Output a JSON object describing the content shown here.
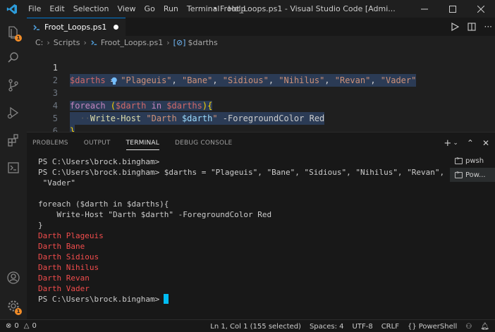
{
  "titlebar": {
    "menu": [
      "File",
      "Edit",
      "Selection",
      "View",
      "Go",
      "Run",
      "Terminal",
      "Help"
    ],
    "title": "• Froot_Loops.ps1 - Visual Studio Code [Admi..."
  },
  "activitybar": {
    "icons": [
      "explorer-icon",
      "search-icon",
      "source-control-icon",
      "run-debug-icon",
      "extensions-icon",
      "remote-explorer-icon"
    ],
    "explorer_badge": "1",
    "settings_badge": "1"
  },
  "editor": {
    "tab_label": "Froot_Loops.ps1",
    "breadcrumb": [
      "C:",
      "Scripts",
      "Froot_Loops.ps1",
      "$darths"
    ],
    "line_numbers": [
      "1",
      "2",
      "3",
      "4",
      "5",
      "6"
    ],
    "line1": {
      "var": "$darths",
      "assign": " = ",
      "items": [
        "\"Plageuis\"",
        "\"Bane\"",
        "\"Sidious\"",
        "\"Nihilus\"",
        "\"Revan\"",
        "\"Vader\""
      ],
      "sep": ", "
    },
    "line3": {
      "keyword": "foreach",
      "open": " (",
      "var1": "$darth",
      "in": " in ",
      "var2": "$darths",
      "close": "){"
    },
    "line4": {
      "indent": "  ··",
      "cmd": "Write-Host",
      "str_open": " \"Darth ",
      "str_var": "$darth",
      "str_close": "\"",
      "param": " -ForegroundColor",
      "value": " Red"
    },
    "line5": "}"
  },
  "panel": {
    "tabs": [
      "PROBLEMS",
      "OUTPUT",
      "TERMINAL",
      "DEBUG CONSOLE"
    ],
    "active_tab": "TERMINAL",
    "terminal_lines": [
      "PS C:\\Users\\brock.bingham>",
      "PS C:\\Users\\brock.bingham> $darths = \"Plageuis\", \"Bane\", \"Sidious\", \"Nihilus\", \"Revan\",",
      " \"Vader\"",
      "",
      "foreach ($darth in $darths){",
      "    Write-Host \"Darth $darth\" -ForegroundColor Red",
      "}"
    ],
    "output_lines": [
      "Darth Plageuis",
      "Darth Bane",
      "Darth Sidious",
      "Darth Nihilus",
      "Darth Revan",
      "Darth Vader"
    ],
    "final_prompt": "PS C:\\Users\\brock.bingham>",
    "terminal_list": [
      "pwsh",
      "Pow..."
    ]
  },
  "statusbar": {
    "errors": "0",
    "warnings": "0",
    "position": "Ln 1, Col 1 (155 selected)",
    "spaces": "Spaces: 4",
    "encoding": "UTF-8",
    "eol": "CRLF",
    "language": "PowerShell"
  },
  "colors": {
    "accent": "#0078d4",
    "terminal_red": "#f14c4c",
    "cursor": "#00bcf2",
    "badge": "#f28c28"
  }
}
